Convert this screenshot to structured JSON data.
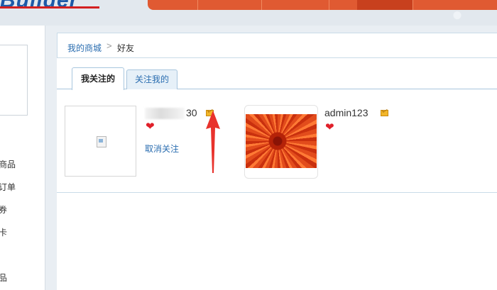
{
  "header": {
    "logo_text": "Builder",
    "nav_items": [
      "",
      "",
      "",
      "",
      ""
    ]
  },
  "sidebar": {
    "links": [
      "商品",
      "订单",
      "券",
      "卡",
      "品"
    ]
  },
  "breadcrumb": {
    "home": "我的商城",
    "separator": ">",
    "current": "好友"
  },
  "tabs": {
    "following": "我关注的",
    "followers": "关注我的"
  },
  "friends": [
    {
      "name_visible_suffix": "30",
      "unfollow_label": "取消关注"
    },
    {
      "name": "admin123"
    }
  ],
  "colors": {
    "nav_bg": "#e05a32",
    "link": "#2a6db0",
    "heart": "#e0202a",
    "annotation_arrow": "#e8322c"
  },
  "icons": {
    "message": "mail-icon",
    "favorite": "heart-icon",
    "annotation": "arrow-up-icon"
  }
}
